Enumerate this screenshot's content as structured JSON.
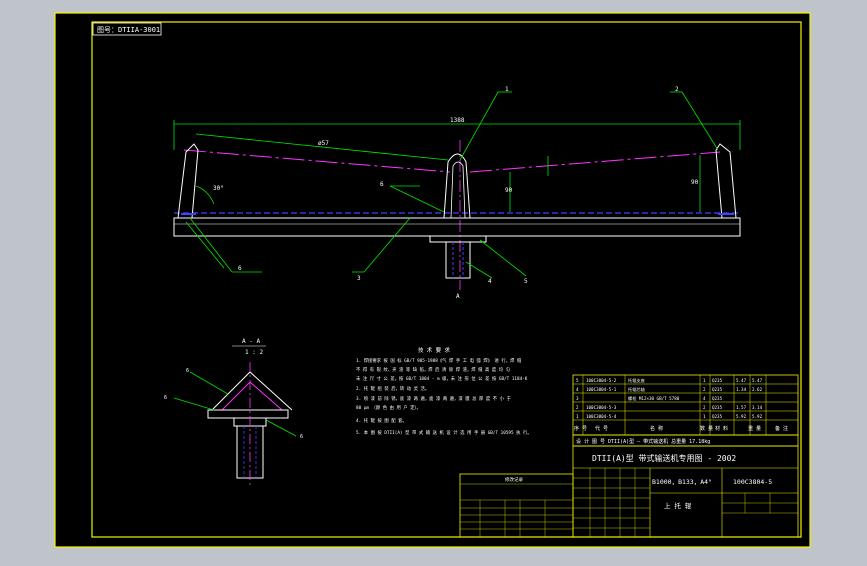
{
  "drawing_code_box": "图号：DTIIA-3001",
  "title_block": {
    "series_title": "DTII(A)型  带式输送机专用图 - 2002",
    "spec": "B1000，B133，A4°",
    "drawing_number": "100C3804-5",
    "part_name": "上 托 辊"
  },
  "parts_list_header": {
    "no": "序 号",
    "code": "代    号",
    "name": "名    称",
    "qty": "数 量",
    "material": "材 料",
    "weight": "重 量",
    "remark": "备 注"
  },
  "parts_list_rows": [
    {
      "no": "5",
      "code": "100C3804-5-2",
      "name": "托辊支座",
      "qty": "1",
      "material": "Q235",
      "weight": "5.47",
      "remark": "5.47"
    },
    {
      "no": "4",
      "code": "100C3804-5-1",
      "name": "托辊芯轴",
      "qty": "2",
      "material": "Q235",
      "weight": "1.34",
      "remark": "2.62"
    },
    {
      "no": "3",
      "code": "",
      "name": "螺栓 M12×30 GB/T 5780",
      "qty": "4",
      "material": "Q235",
      "weight": "",
      "remark": ""
    },
    {
      "no": "2",
      "code": "100C3804-5-3",
      "name": "",
      "qty": "2",
      "material": "Q235",
      "weight": "1.57",
      "remark": "3.14"
    },
    {
      "no": "1",
      "code": "100C3804-5-4",
      "name": "",
      "qty": "1",
      "material": "Q235",
      "weight": "5.92",
      "remark": "5.92"
    }
  ],
  "bottom_row": {
    "text": "设 计 图 号    DTII(A)型 — 带式输送机    总重量  17.18kg"
  },
  "revision_header": "修改记录",
  "notes_title": "技 术 要 求",
  "notes": [
    "1. 焊接要求 按 国 标 GB/T 985-1988《气 焊 手 工 电 弧 焊》 进 行，焊 缝",
    "   不 得 有 裂 纹、夹 渣 等 缺 陷，焊 后 清 除 焊 渣，焊 缝 高 度 均 匀",
    "   未 注 尺 寸 公 差，按 GB/T 1804 - m 级，未 注 形 位 公 差 按 GB/T 1184-K",
    "2. 托 辊 组 装 后，转 动 灵 活。",
    "3. 喷 漆 前 除 锈，底 漆 两 遍，面 漆 两 遍，漆 膜 总 厚 度 不 小 于 ",
    "   80 μm （颜 色 由 用 户 定）。",
    "4. 托 辊 按 图 配 套。",
    "5. 本 图 按 DTII(A) 型 带 式 输 送 机 设 计 选 用 手 册 GB/T 10595 执 行。"
  ],
  "section_label": "A - A",
  "section_scale": "1 : 2",
  "dim_width": "1388",
  "dim_slope": "ø57",
  "dim_angle": "30°",
  "dim_height_left": "90",
  "dim_height_right": "90",
  "view_label": "A",
  "balloons": {
    "b1": "1",
    "b2": "2",
    "b3": "3",
    "b4": "4",
    "b5": "5"
  },
  "leader_labels": {
    "weld1": "6",
    "weld2": "6",
    "weld3": "5",
    "weld_a": "6",
    "weld_b": "6",
    "weld_c": "6"
  },
  "colors": {
    "frame_bg": "#000000",
    "outer_bg": "#bfc4cb",
    "border": "#f2f200",
    "geometry": "#ffffff",
    "dimension": "#00e600",
    "center_line": "#ff33ff",
    "hidden_line": "#4040ff",
    "title_text": "#ffffff"
  }
}
